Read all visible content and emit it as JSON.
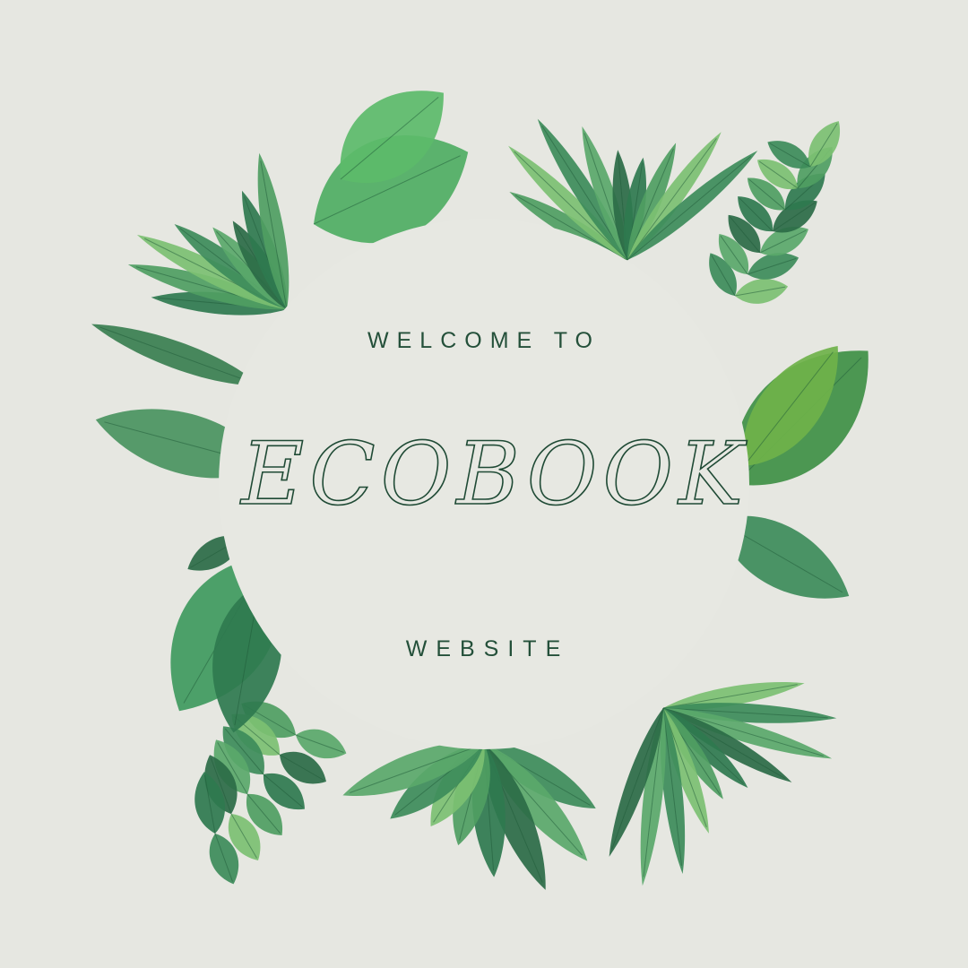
{
  "poster": {
    "subtitle_top": "WELCOME TO",
    "title": "ECOBOOK",
    "subtitle_bottom": "WEBSITE"
  },
  "colors": {
    "background": "#e6e7e1",
    "text": "#24503a",
    "leaf_dark": "#2f7a4f",
    "leaf_mid": "#4f9e62",
    "leaf_light": "#7cc072"
  }
}
